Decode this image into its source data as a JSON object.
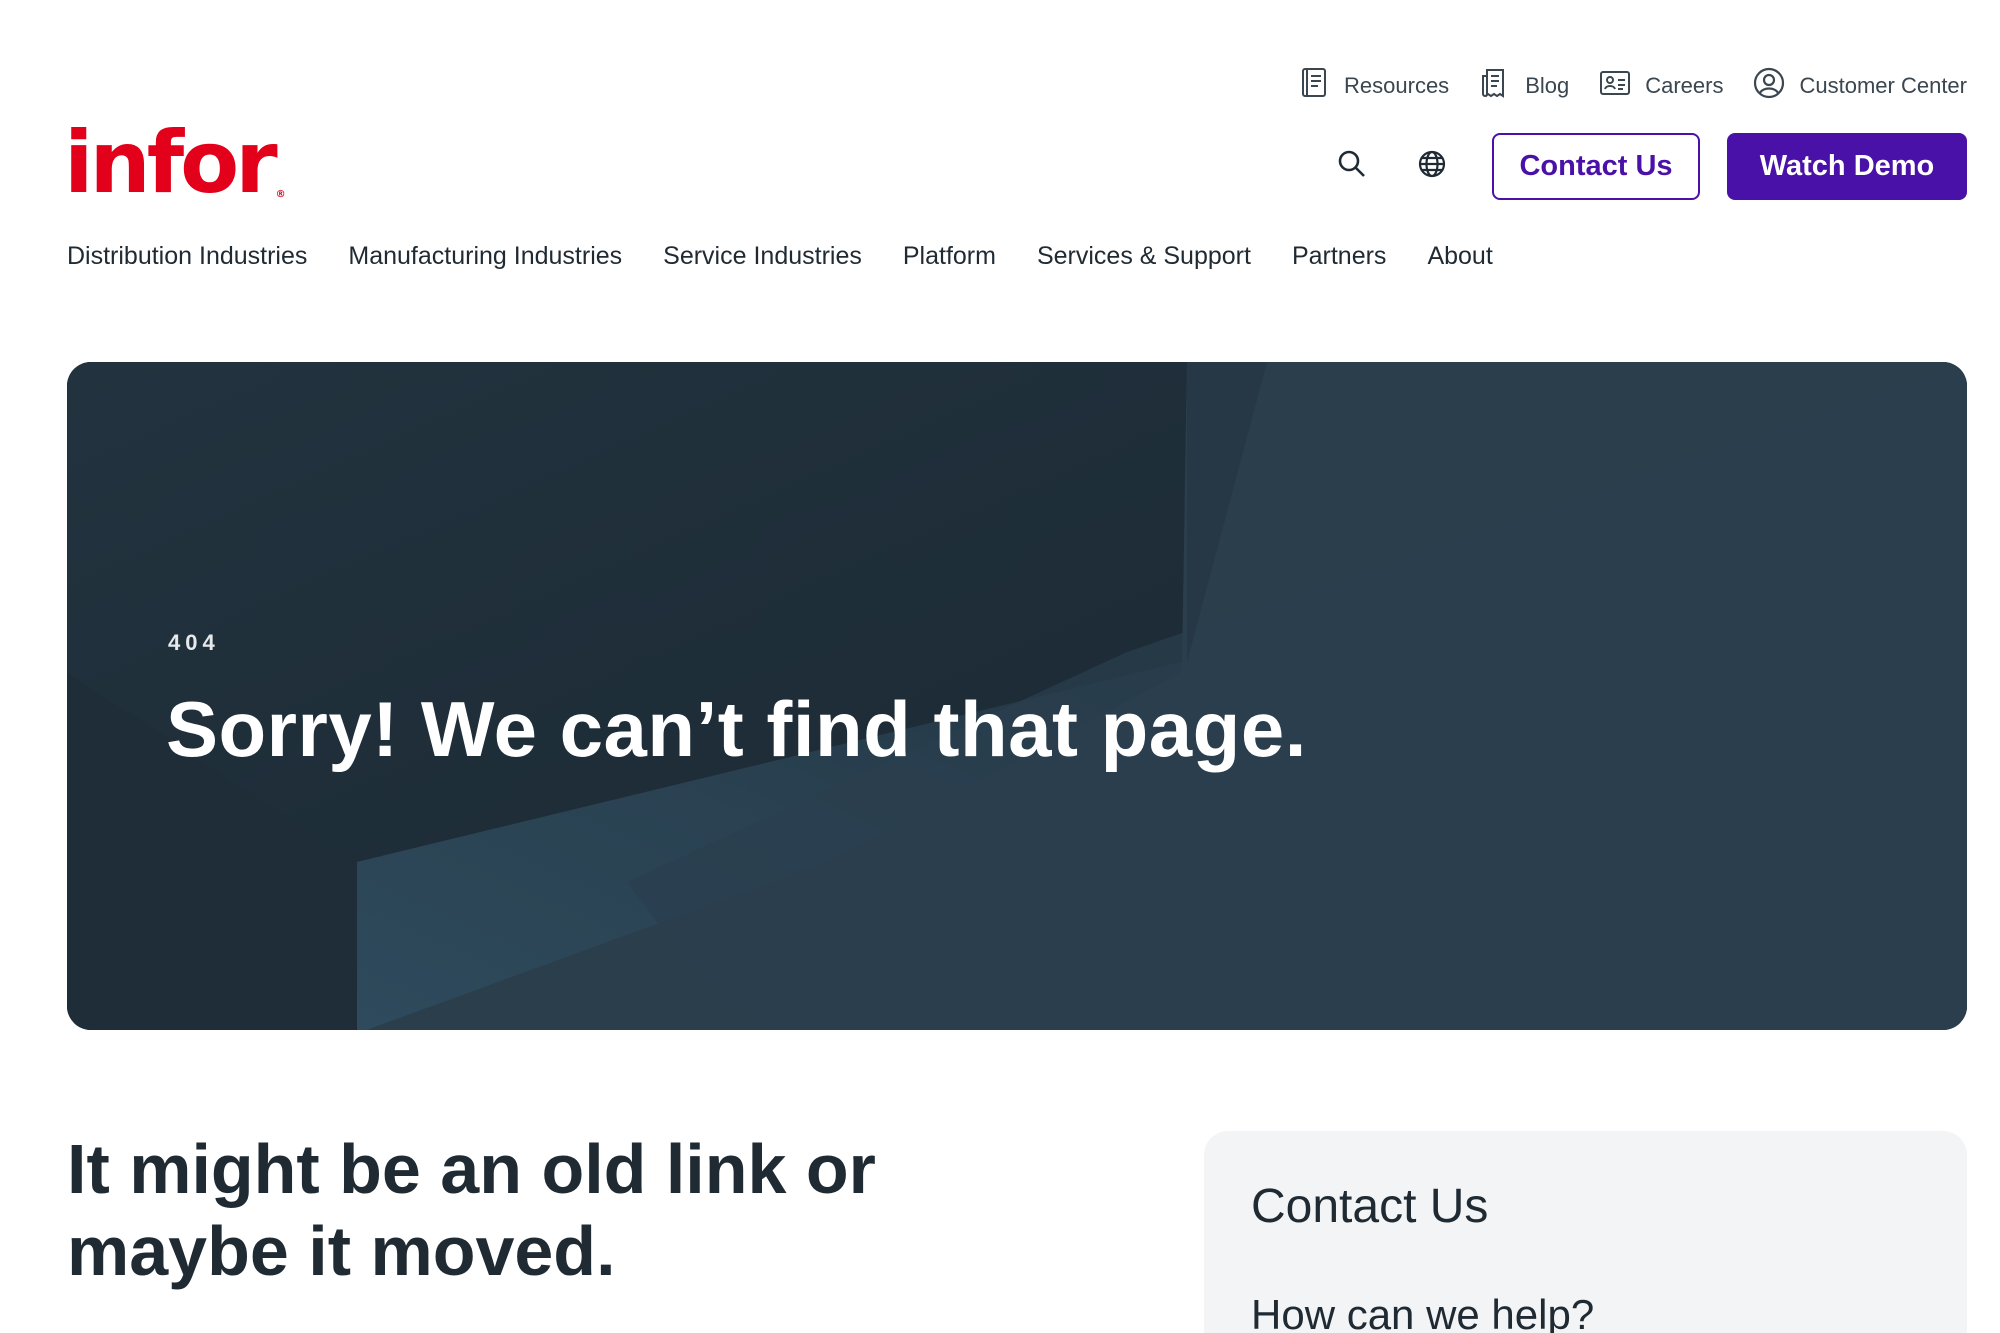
{
  "utility": {
    "resources": "Resources",
    "blog": "Blog",
    "careers": "Careers",
    "customer_center": "Customer Center"
  },
  "logo": {
    "text": "infor",
    "mark": "®"
  },
  "header": {
    "contact_label": "Contact Us",
    "demo_label": "Watch Demo"
  },
  "nav": [
    "Distribution Industries",
    "Manufacturing Industries",
    "Service Industries",
    "Platform",
    "Services & Support",
    "Partners",
    "About"
  ],
  "hero": {
    "eyebrow": "404",
    "title": "Sorry! We can’t find that page."
  },
  "content": {
    "subheading_line1": "It might be an old link or",
    "subheading_line2": "maybe it moved."
  },
  "contact_card": {
    "title": "Contact Us",
    "question": "How can we help?"
  },
  "colors": {
    "brand_red": "#e2001a",
    "accent_purple": "#4a11a8",
    "hero_bg": "#283a48",
    "card_bg": "#f3f4f5"
  },
  "icons": [
    "book-icon",
    "blog-icon",
    "id-card-icon",
    "user-circle-icon",
    "search-icon",
    "globe-icon"
  ]
}
